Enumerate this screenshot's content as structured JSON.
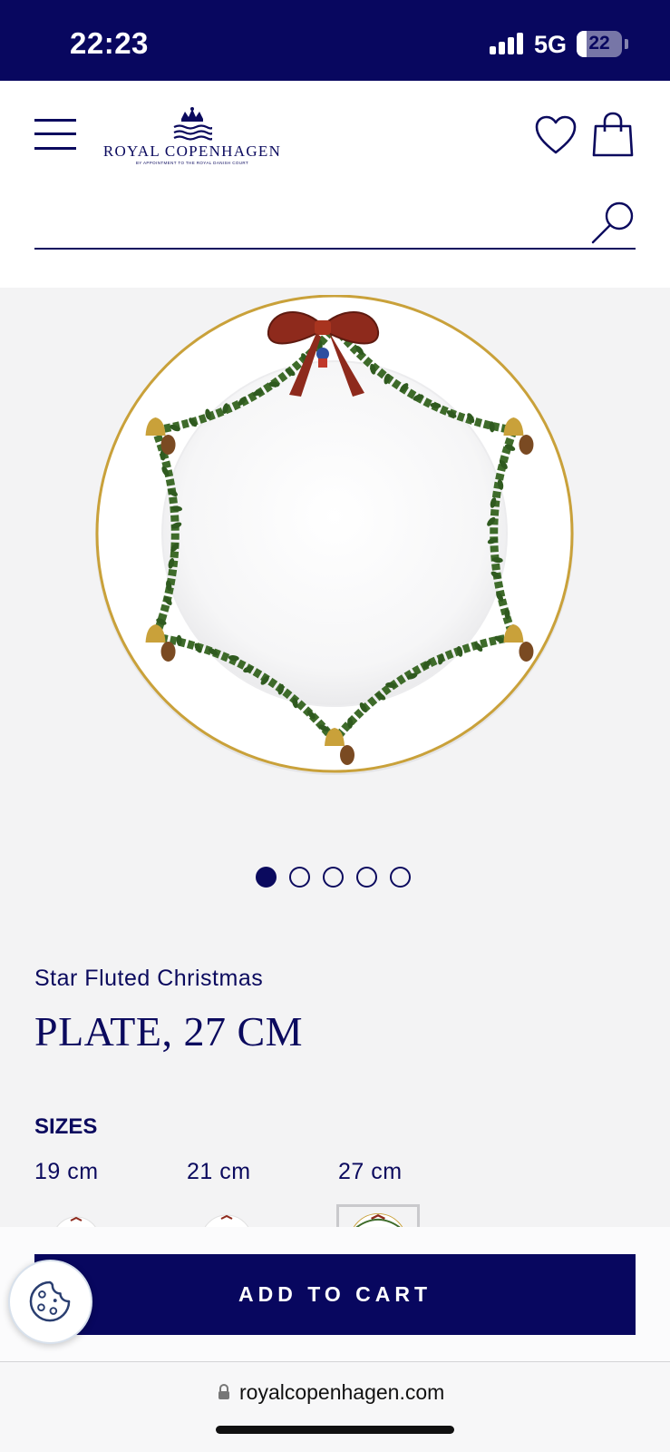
{
  "status_bar": {
    "time": "22:23",
    "network": "5G",
    "battery": "22",
    "battery_level_percent": 22
  },
  "header": {
    "brand_name": "ROYAL COPENHAGEN",
    "brand_tagline": "BY APPOINTMENT TO THE ROYAL DANISH COURT",
    "icons": {
      "menu": "hamburger-menu-icon",
      "wishlist": "heart-icon",
      "bag": "shopping-bag-icon",
      "search": "search-icon"
    },
    "search_value": ""
  },
  "gallery": {
    "slide_count": 5,
    "active_slide": 1
  },
  "product": {
    "collection": "Star Fluted Christmas",
    "title": "PLATE, 27 CM",
    "sizes_heading": "SIZES",
    "sizes": [
      {
        "label": "19 cm",
        "selected": false
      },
      {
        "label": "21 cm",
        "selected": false
      },
      {
        "label": "27 cm",
        "selected": true
      }
    ]
  },
  "cart": {
    "add_to_cart_label": "ADD TO CART",
    "cookie_icon": "cookie-icon"
  },
  "browser": {
    "url": "royalcopenhagen.com",
    "lock_icon": "lock-icon"
  },
  "colors": {
    "brand_navy": "#08075f",
    "background_gray": "#f3f3f4",
    "gold": "#c9a13a",
    "garland_green": "#3e6b2a",
    "ribbon_red": "#8e2a1c"
  }
}
